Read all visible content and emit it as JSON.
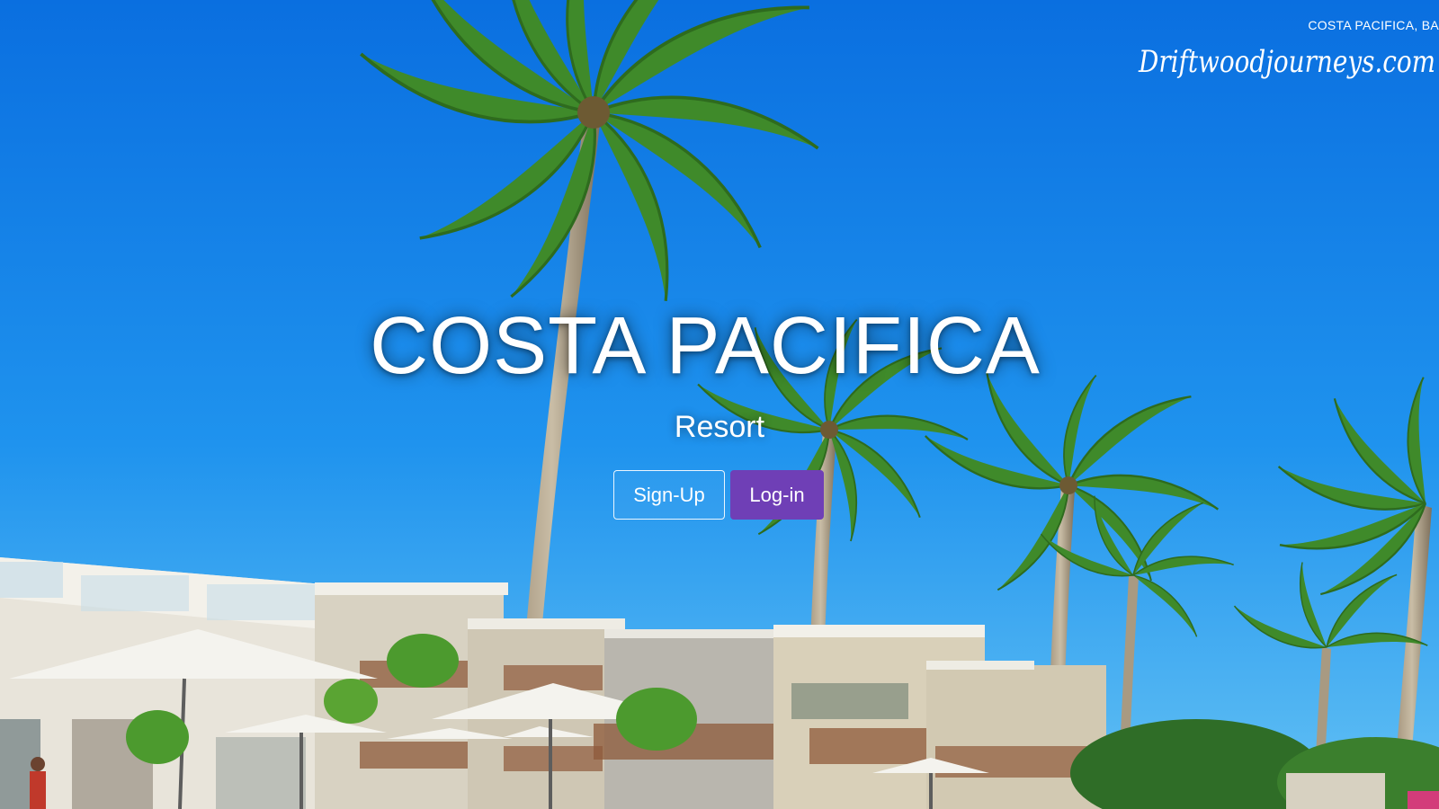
{
  "watermark": {
    "caption": "COSTA PACIFICA, BA",
    "logo_text": "Driftwoodjourneys.com"
  },
  "hero": {
    "title": "COSTA PACIFICA",
    "subtitle": "Resort"
  },
  "actions": {
    "signup_label": "Sign-Up",
    "login_label": "Log-in"
  },
  "colors": {
    "sky_top": "#0a6fe0",
    "sky_bottom": "#4db6f2",
    "login_button": "#6f3fb6",
    "palm_green": "#3f8a2a",
    "building": "#e8e4da"
  }
}
